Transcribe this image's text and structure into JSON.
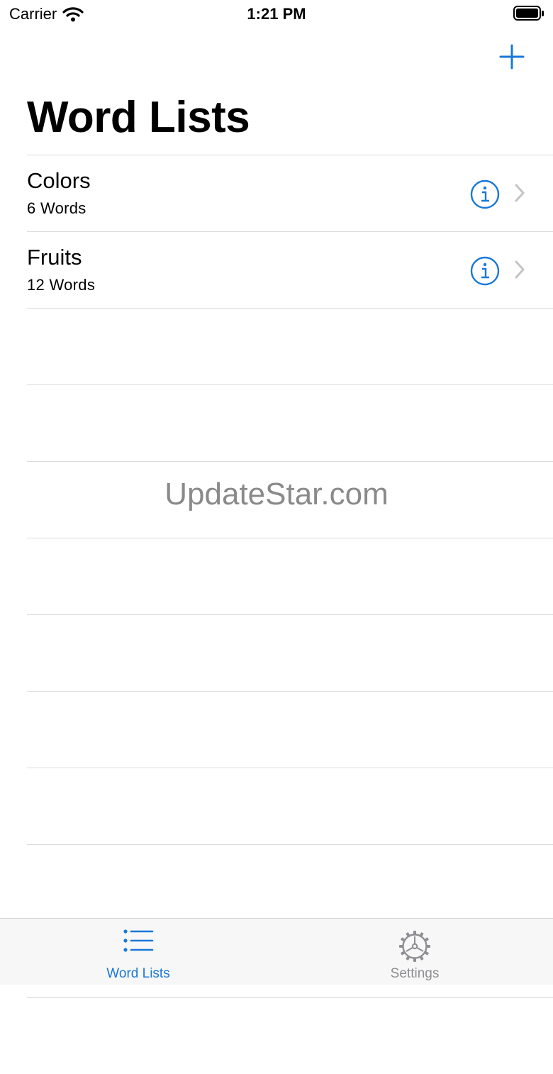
{
  "status_bar": {
    "carrier": "Carrier",
    "time": "1:21 PM",
    "icons": [
      "wifi-icon",
      "battery-icon"
    ]
  },
  "nav": {
    "title": "Word Lists",
    "add_icon": "plus-icon"
  },
  "lists": [
    {
      "title": "Colors",
      "subtitle": "6 Words"
    },
    {
      "title": "Fruits",
      "subtitle": "12 Words"
    }
  ],
  "watermark": "UpdateStar.com",
  "tab_bar": {
    "tabs": [
      {
        "label": "Word Lists",
        "icon": "list-icon",
        "active": true
      },
      {
        "label": "Settings",
        "icon": "gear-icon",
        "active": false
      }
    ]
  },
  "colors": {
    "accent": "#1878d8",
    "inactive": "#8e8e93",
    "separator": "#dcdcdf",
    "chevron": "#c4c4c7"
  }
}
